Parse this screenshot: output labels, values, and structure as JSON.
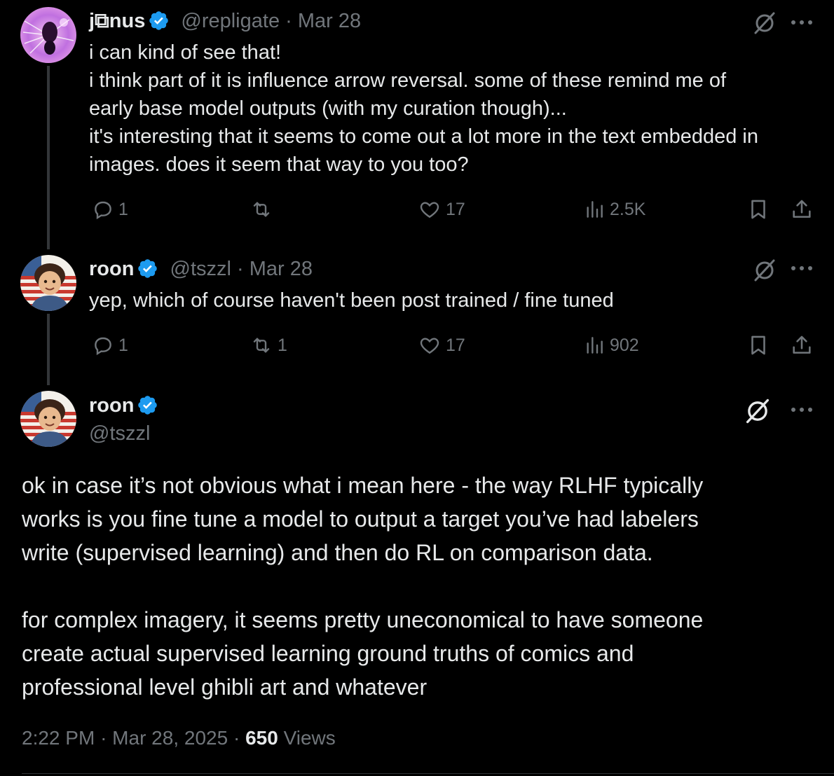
{
  "tweets": [
    {
      "name": "j⧉nus",
      "handle": "@repligate",
      "separator": "·",
      "date": "Mar 28",
      "lines": [
        "i can kind of see that!",
        "i think part of it is influence arrow reversal. some of these remind me of",
        "early base model outputs (with my curation though)...",
        "it's interesting that it seems to come out a lot more in the text embedded in",
        "images. does it seem that way to you too?"
      ],
      "replies": "1",
      "reposts": "",
      "likes": "17",
      "views": "2.5K"
    },
    {
      "name": "roon",
      "handle": "@tszzl",
      "separator": "·",
      "date": "Mar 28",
      "lines": [
        "yep, which of course haven't been post trained / fine tuned"
      ],
      "replies": "1",
      "reposts": "1",
      "likes": "17",
      "views": "902"
    }
  ],
  "main_tweet": {
    "name": "roon",
    "handle": "@tszzl",
    "paragraph_lines": [
      "ok in case it’s not obvious what i mean here - the way RLHF typically",
      "works is you fine tune a model to output a target you’ve had labelers",
      "write (supervised learning) and then do RL on comparison data.",
      "",
      "for complex imagery, it seems pretty uneconomical to have someone",
      "create actual supervised learning ground truths of comics and",
      "professional level ghibli art and whatever"
    ],
    "time": "2:22 PM",
    "separator": "·",
    "date": "Mar 28, 2025",
    "separator2": "·",
    "views_count": "650",
    "views_label": "Views"
  },
  "colors": {
    "background": "#000000",
    "text": "#e7e9ea",
    "muted": "#71767b",
    "verified": "#1d9bf0",
    "thread_line": "#333639"
  },
  "icons": [
    "verified-badge-icon",
    "grok-icon",
    "more-icon",
    "reply-icon",
    "repost-icon",
    "like-icon",
    "views-icon",
    "bookmark-icon",
    "share-icon"
  ]
}
